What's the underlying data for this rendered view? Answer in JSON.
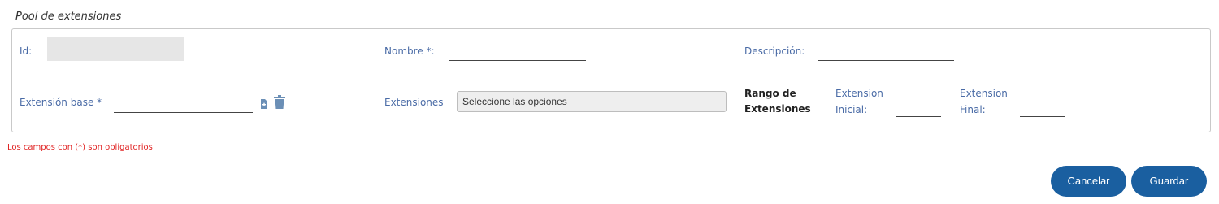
{
  "section": {
    "title": "Pool de extensiones"
  },
  "form": {
    "id_label": "Id:",
    "id_value": "",
    "nombre_label": "Nombre *:",
    "nombre_value": "",
    "descripcion_label": "Descripción:",
    "descripcion_value": "",
    "extension_base_label": "Extensión base *",
    "extension_base_value": "",
    "extensiones_label": "Extensiones",
    "extensiones_placeholder": "Seleccione las opciones",
    "rango_label_line1": "Rango de",
    "rango_label_line2": "Extensiones",
    "ext_inicial_line1": "Extension",
    "ext_inicial_line2": "Inicial:",
    "ext_inicial_value": "",
    "ext_final_line1": "Extension",
    "ext_final_line2": "Final:",
    "ext_final_value": ""
  },
  "icons": {
    "add": "file-add-icon",
    "delete": "trash-icon"
  },
  "colors": {
    "label": "#4a6ba6",
    "primary_button": "#1a5fa0",
    "required_note": "#e02020"
  },
  "notes": {
    "required": "Los campos con (*) son obligatorios"
  },
  "buttons": {
    "cancel": "Cancelar",
    "save": "Guardar"
  }
}
